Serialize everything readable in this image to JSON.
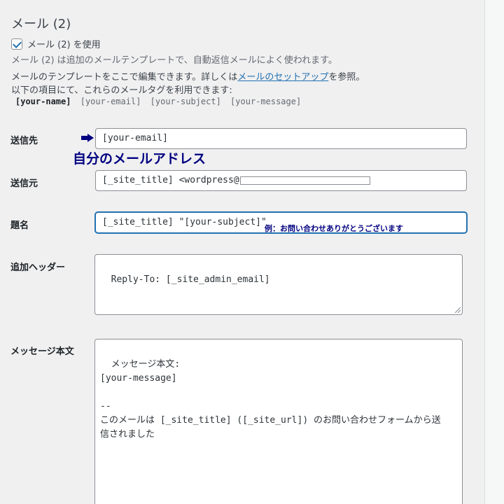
{
  "section": {
    "title": "メール (2)",
    "use_checkbox_label": "メール (2) を使用",
    "description": "メール (2) は追加のメールテンプレートで、自動返信メールによく使われます。",
    "template_note_prefix": "メールのテンプレートをここで編集できます。詳しくは",
    "template_note_link": "メールのセットアップ",
    "template_note_suffix": "を参照。",
    "tags_note": "以下の項目にて、これらのメールタグを利用できます:",
    "tags": [
      "[your-name]",
      "[your-email]",
      "[your-subject]",
      "[your-message]"
    ]
  },
  "fields": {
    "to": {
      "label": "送信先",
      "value": "[your-email]"
    },
    "from": {
      "label": "送信元",
      "value": "[_site_title] <wordpress@"
    },
    "subject": {
      "label": "題名",
      "value": "[_site_title] \"[your-subject]\""
    },
    "headers": {
      "label": "追加ヘッダー",
      "value": "Reply-To: [_site_admin_email]"
    },
    "body": {
      "label": "メッセージ本文",
      "value": "メッセージ本文:\n[your-message]\n\n--\nこのメールは [_site_title] ([_site_url]) のお問い合わせフォームから送\n信されました"
    }
  },
  "annotations": {
    "to_note": "自分のメールアドレス",
    "subject_note": "例：お問い合わせありがとうございます"
  },
  "icons": {
    "arrow": "right-arrow-icon",
    "check": "checkmark-icon"
  }
}
